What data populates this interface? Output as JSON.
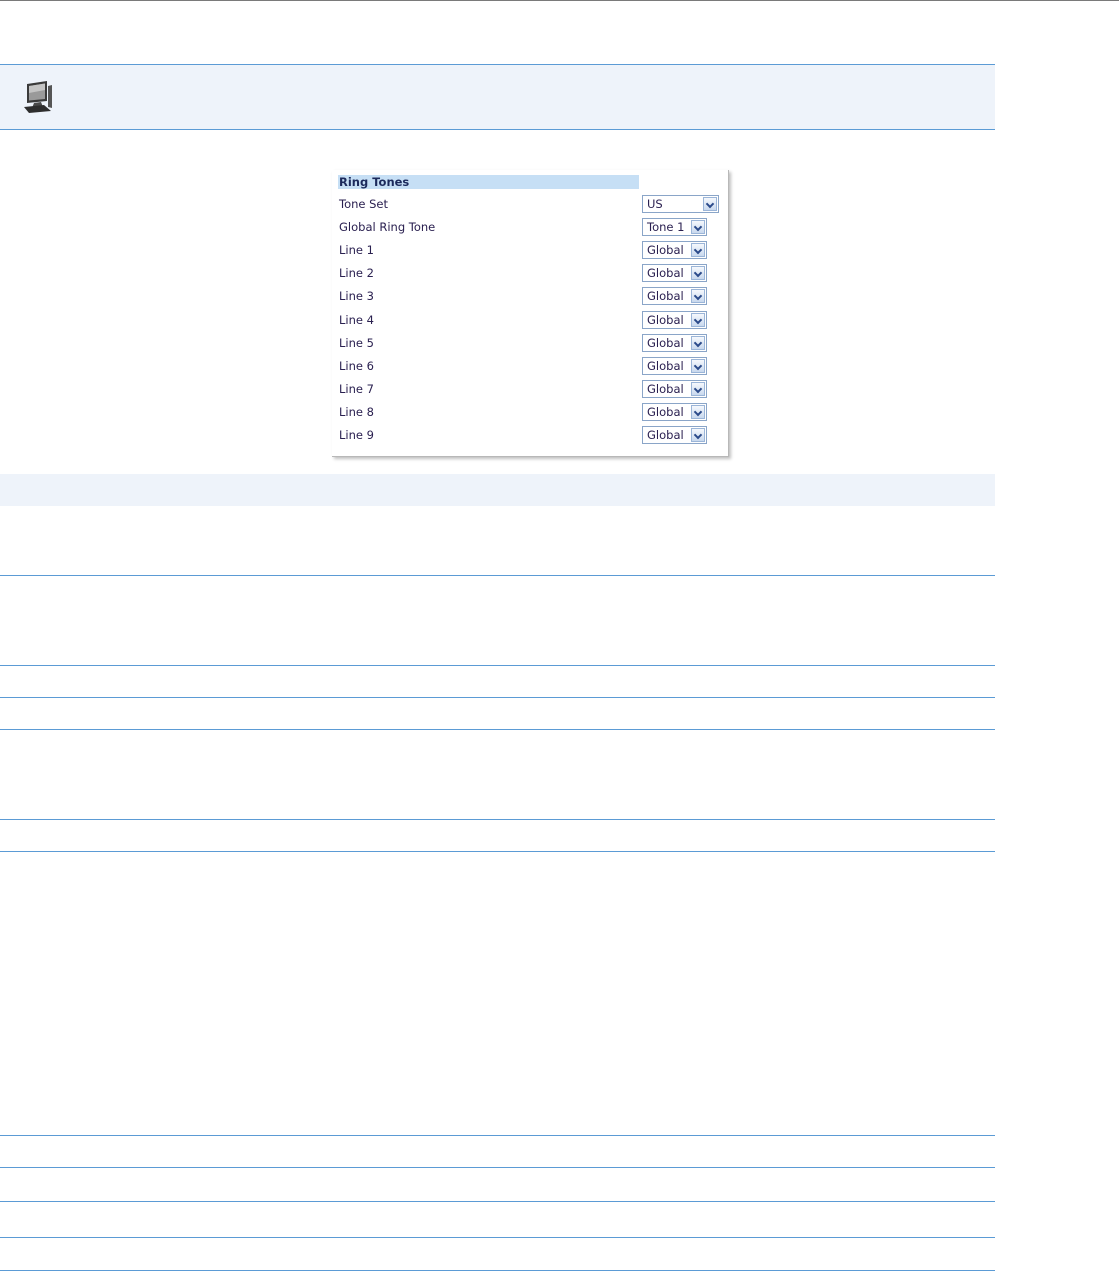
{
  "panel": {
    "title": "Ring Tones",
    "rows": [
      {
        "label": "Tone Set",
        "value": "US"
      },
      {
        "label": "Global Ring Tone",
        "value": "Tone 1"
      },
      {
        "label": "Line 1",
        "value": "Global"
      },
      {
        "label": "Line 2",
        "value": "Global"
      },
      {
        "label": "Line 3",
        "value": "Global"
      },
      {
        "label": "Line 4",
        "value": "Global"
      },
      {
        "label": "Line 5",
        "value": "Global"
      },
      {
        "label": "Line 6",
        "value": "Global"
      },
      {
        "label": "Line 7",
        "value": "Global"
      },
      {
        "label": "Line 8",
        "value": "Global"
      },
      {
        "label": "Line 9",
        "value": "Global"
      }
    ]
  },
  "icons": {
    "header": "computer-icon",
    "dropdown": "chevron-down-icon"
  },
  "colors": {
    "rule": "#5b9bd5",
    "band": "#eef3fa",
    "panel_header": "#c6dff5"
  }
}
